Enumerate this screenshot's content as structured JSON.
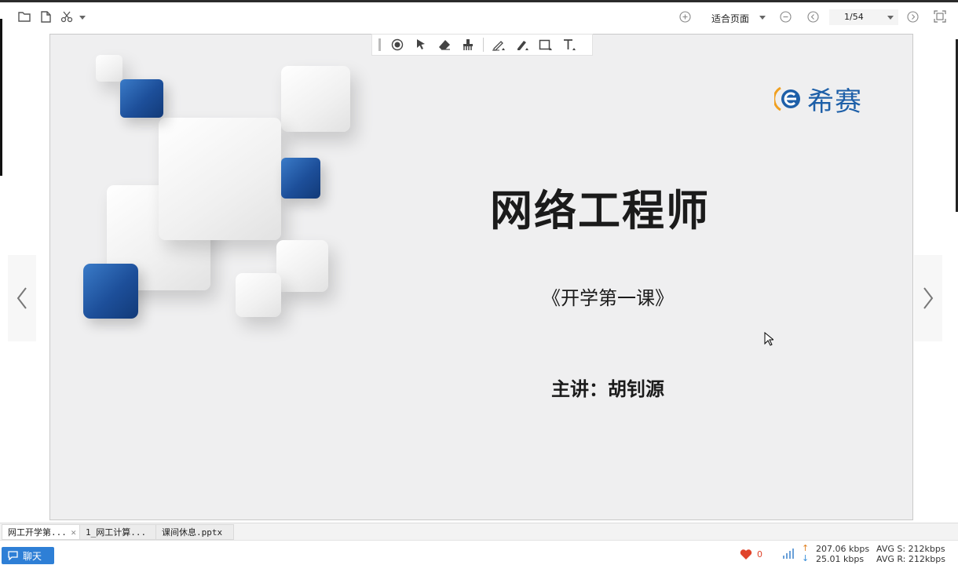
{
  "toolbar": {
    "zoom_label": "适合页面",
    "page_indicator": "1/54"
  },
  "slide": {
    "title": "网络工程师",
    "subtitle": "《开学第一课》",
    "speaker": "主讲：胡钊源",
    "logo_text": "希赛",
    "colors": {
      "accent_blue": "#1d5fa8",
      "tile_blue": "#1d4f9a",
      "background": "#efeff0"
    }
  },
  "tabs": [
    {
      "label": "网工开学第..."
    },
    {
      "label": "1_网工计算..."
    },
    {
      "label": "课间休息.pptx"
    }
  ],
  "status": {
    "chat_label": "聊天",
    "likes": "0",
    "upload_speed": "207.06 kbps",
    "download_speed": "25.01 kbps",
    "avg_send": "AVG S: 212kbps",
    "avg_recv": "AVG R: 212kbps"
  },
  "icons": {
    "toolbar_left": [
      "folder-icon",
      "file-icon",
      "scissors-icon"
    ],
    "toolbar_right": [
      "zoom-in-icon",
      "zoom-out-icon",
      "prev-page-icon",
      "next-page-icon",
      "fullscreen-icon"
    ],
    "annotation": [
      "laser-pointer-icon",
      "select-arrow-icon",
      "eraser-icon",
      "clear-brush-icon",
      "pen-icon",
      "highlighter-icon",
      "rectangle-icon",
      "text-icon"
    ]
  }
}
